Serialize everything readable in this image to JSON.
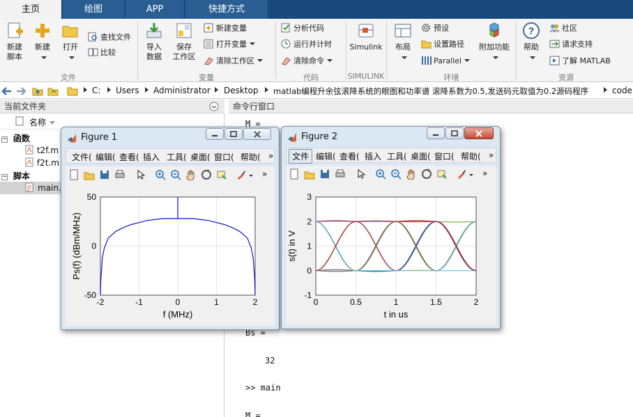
{
  "tabs": [
    "主页",
    "绘图",
    "APP",
    "快捷方式"
  ],
  "ribbon": {
    "file": {
      "new_script": "新建\n脚本",
      "new": "新建",
      "open": "打开",
      "find_files": "查找文件",
      "compare": "比较",
      "label": "文件"
    },
    "variable": {
      "import_data": "导入\n数据",
      "save_workspace": "保存\n工作区",
      "new_variable": "新建变量",
      "open_variable": "打开变量",
      "clear_workspace": "清除工作区",
      "label": "变量"
    },
    "code": {
      "analyze_code": "分析代码",
      "run_and_time": "运行并计时",
      "clear_commands": "清除命令",
      "label": "代码"
    },
    "simulink": {
      "simulink": "Simulink",
      "label": "SIMULINK"
    },
    "environment": {
      "layout": "布局",
      "preferences": "预设",
      "set_path": "设置路径",
      "parallel": "Parallel",
      "addons": "附加功能",
      "label": "环境"
    },
    "resources": {
      "help": "帮助",
      "community": "社区",
      "request_support": "请求支持",
      "learn_matlab": "了解 MATLAB",
      "label": "资源"
    }
  },
  "address": [
    "C:",
    "Users",
    "Administrator",
    "Desktop",
    "matlab编程升余弦滚降系统的眼图和功率谱 滚降系数为0.5,发送码元取值为0.2源码程序",
    "code"
  ],
  "current_folder": {
    "title": "当前文件夹",
    "name_col": "名称",
    "group_functions": "函数",
    "files_functions": [
      "t2f.m",
      "f2t.m"
    ],
    "group_scripts": "脚本",
    "files_scripts": [
      "main.m"
    ]
  },
  "command_window": {
    "title": "命令行窗口",
    "lines": [
      "M =",
      "Bs =",
      "32",
      ">> main",
      "M ="
    ]
  },
  "figure1": {
    "title": "Figure 1",
    "menus": [
      "文件(",
      "编辑(",
      "查看(",
      "插入",
      "工具(",
      "桌面(",
      "窗口(",
      "帮助("
    ],
    "chart": {
      "xlabel": "f (MHz)",
      "ylabel": "Ps(f)  (dBm/MHz)",
      "xticks": [
        "-2",
        "-1",
        "0",
        "1",
        "2"
      ],
      "yticks": [
        "50",
        "0",
        "-50"
      ]
    }
  },
  "figure2": {
    "title": "Figure 2",
    "menus": [
      "文件",
      "编辑(",
      "查看(",
      "插入",
      "工具(",
      "桌面(",
      "窗口(",
      "帮助("
    ],
    "chart": {
      "xlabel": "t in us",
      "ylabel": "s(t) in V",
      "xticks": [
        "0",
        "0.5",
        "1",
        "1.5",
        "2"
      ],
      "yticks": [
        "3",
        "2",
        "1",
        "0",
        "-1"
      ]
    }
  },
  "chart_data": [
    {
      "type": "line",
      "xlabel": "f (MHz)",
      "ylabel": "Ps(f)  (dBm/MHz)",
      "xlim": [
        -2,
        2
      ],
      "ylim": [
        -50,
        50
      ],
      "grid": true,
      "series": [
        {
          "x": [
            -2,
            -1.99,
            -1.95,
            -1.9,
            -1.8,
            -1.6,
            -1.4,
            -1.2,
            -1,
            -0.8,
            -0.6,
            -0.4,
            -0.2,
            0,
            0.2,
            0.4,
            0.6,
            0.8,
            1,
            1.2,
            1.4,
            1.6,
            1.8,
            1.9,
            1.95,
            1.99,
            2
          ],
          "y": [
            -50,
            -35,
            -12,
            -2,
            8,
            15,
            19,
            22,
            24,
            26,
            27,
            28,
            28,
            28,
            28,
            28,
            27,
            26,
            24,
            22,
            19,
            15,
            8,
            -2,
            -12,
            -35,
            -50
          ]
        }
      ],
      "annotations": [
        {
          "type": "spike",
          "x": 0,
          "y_top": 50
        }
      ]
    },
    {
      "type": "line",
      "xlabel": "t in us",
      "ylabel": "s(t) in V",
      "xlim": [
        0,
        2
      ],
      "ylim": [
        -1,
        3
      ],
      "grid": true,
      "levels": [
        0,
        2
      ],
      "series_colors": [
        "#0072bd",
        "#d95319",
        "#edb120",
        "#7e2f8e",
        "#77ac30",
        "#4dbeee",
        "#a2142f"
      ],
      "description_levels": "eye diagram: traces transition between 0 and 2 V with crossings at t = 0.25, 0.75, 1.25, 1.75 us and level 1 V"
    }
  ]
}
